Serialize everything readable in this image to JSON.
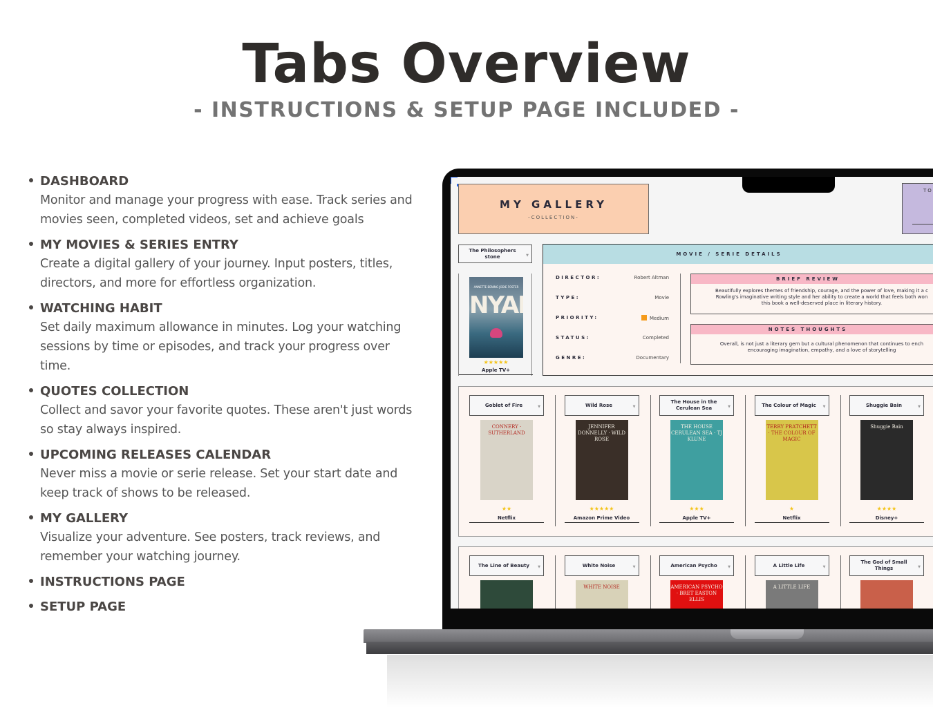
{
  "header": {
    "title": "Tabs Overview",
    "subtitle": "- INSTRUCTIONS & SETUP PAGE INCLUDED -"
  },
  "features": [
    {
      "title": "DASHBOARD",
      "description": "Monitor and manage your progress with ease. Track series and movies seen, completed videos, set and achieve goals"
    },
    {
      "title": "MY MOVIES & SERIES ENTRY",
      "description": "Create a digital gallery of your journey. Input posters, titles, directors, and more for effortless organization."
    },
    {
      "title": "WATCHING HABIT",
      "description": "Set daily maximum allowance in minutes. Log your watching sessions by time or episodes, and track your progress over time."
    },
    {
      "title": "QUOTES COLLECTION",
      "description": "Collect and savor your favorite quotes. These aren't just words so stay always inspired."
    },
    {
      "title": "UPCOMING RELEASES CALENDAR",
      "description": "Never miss a movie or serie release. Set your start date and keep track of shows to be released."
    },
    {
      "title": "MY GALLERY",
      "description": "Visualize your adventure. See posters, track reviews, and remember your watching journey."
    },
    {
      "title": "INSTRUCTIONS PAGE",
      "description": ""
    },
    {
      "title": "SETUP PAGE",
      "description": ""
    }
  ],
  "screen": {
    "gallery_title": "MY GALLERY",
    "gallery_subtitle": "-COLLECTION-",
    "purple_box_label": "TO",
    "featured": {
      "selected": "The Philosophers stone",
      "poster_text": "NYAD",
      "poster_tagline": "ANNETTE BENING  JODIE FOSTER",
      "stars": 5,
      "platform": "Apple TV+"
    },
    "details": {
      "header": "MOVIE / SERIE DETAILS",
      "fields": [
        {
          "label": "DIRECTOR:",
          "value": "Robert Altman"
        },
        {
          "label": "TYPE:",
          "value": "Movie"
        },
        {
          "label": "PRIORITY:",
          "value": "Medium"
        },
        {
          "label": "STATUS:",
          "value": "Completed"
        },
        {
          "label": "GENRE:",
          "value": "Documentary"
        }
      ],
      "priority_color": "#f59a1a",
      "brief_review_header": "BRIEF REVIEW",
      "brief_review_lines": [
        "Beautifully explores themes of friendship, courage, and the power of love, making it a c",
        "Rowling's imaginative writing style and her ability to create a world that feels both won",
        "this book a well-deserved place in literary history."
      ],
      "notes_header": "NOTES THOUGHTS",
      "notes_lines": [
        "Overall, is not just a literary gem but a cultural phenomenon that continues to ench",
        "encouraging imagination, empathy, and a love of storytelling"
      ]
    },
    "row1": [
      {
        "title": "Goblet of Fire",
        "stars": "★★",
        "platform": "Netflix",
        "poster_text": "CONNERY · SUTHERLAND",
        "color": "#d9d4c8"
      },
      {
        "title": "Wild Rose",
        "stars": "★★★★★",
        "platform": "Amazon Prime Video",
        "poster_text": "JENNIFER DONNELLY · WILD ROSE",
        "color": "#3a2f28"
      },
      {
        "title": "The House in the Cerulean Sea",
        "stars": "★★★",
        "platform": "Apple TV+",
        "poster_text": "THE HOUSE CERULEAN SEA · TJ KLUNE",
        "color": "#3f9fa0"
      },
      {
        "title": "The Colour of Magic",
        "stars": "★",
        "platform": "Netflix",
        "poster_text": "TERRY PRATCHETT · THE COLOUR OF MAGIC",
        "color": "#d8c64a"
      },
      {
        "title": "Shuggie Bain",
        "stars": "★★★★",
        "platform": "Disney+",
        "poster_text": "Shuggie Bain",
        "color": "#2a2a2a"
      }
    ],
    "row2": [
      {
        "title": "The Line of Beauty",
        "poster_text": "",
        "color": "#2e4a3a"
      },
      {
        "title": "White Noise",
        "poster_text": "WHITE NOISE",
        "color": "#d8d2b8"
      },
      {
        "title": "American Psycho",
        "poster_text": "AMERICAN PSYCHO · BRET EASTON ELLIS",
        "color": "#e01010"
      },
      {
        "title": "A Little Life",
        "poster_text": "A LITTLE LIFE",
        "color": "#7a7a7a"
      },
      {
        "title": "The God of Small Things",
        "poster_text": "",
        "color": "#c9604a"
      }
    ]
  }
}
